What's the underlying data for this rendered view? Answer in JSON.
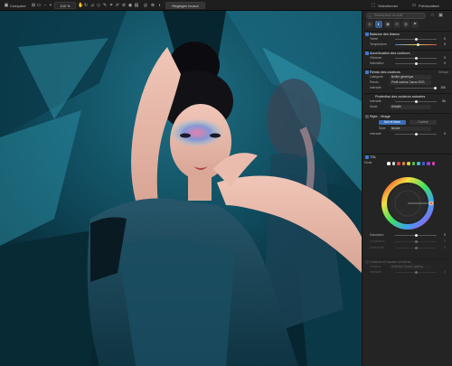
{
  "toolbar": {
    "compare_label": "Comparer",
    "zoom_value": "100 %",
    "preset_button": "Réglages locaux",
    "right_button": "Sélectionner",
    "preview_button": "Prévisualiser"
  },
  "panel": {
    "search_placeholder": "Rechercher un outil",
    "tabs": [
      "◎",
      "◐",
      "▣",
      "⊡",
      "◍",
      "⚑"
    ],
    "sections": {
      "white_balance": {
        "title": "Balance des blancs",
        "rows": [
          {
            "label": "Teinte",
            "value": "0"
          },
          {
            "label": "Température",
            "value": "0"
          }
        ]
      },
      "color_enhance": {
        "title": "Accentuation des couleurs",
        "rows": [
          {
            "label": "Vibrance",
            "value": "0"
          },
          {
            "label": "Saturation",
            "value": "0"
          }
        ]
      },
      "color_render": {
        "title": "Rendu des couleurs",
        "badge": "Défaut",
        "rows": [
          {
            "label": "Catégorie",
            "value": "Boîtier générique"
          },
          {
            "label": "Rendu",
            "value": "Profil couleur Canon EOS"
          },
          {
            "label": "Intensité",
            "value": "100"
          }
        ]
      },
      "skin_protect": {
        "title": "Protection des couleurs saturées",
        "rows": [
          {
            "label": "Intensité",
            "value": "50"
          },
          {
            "label": "Mode",
            "value": "Détaillé"
          }
        ]
      },
      "style_tint": {
        "title": "Style - Virage",
        "buttons": [
          "Noir et blanc",
          "Couleur"
        ],
        "rows": [
          {
            "label": "Style",
            "value": "Neutre"
          },
          {
            "label": "Intensité",
            "value": "0"
          }
        ]
      },
      "hsl": {
        "title": "TSL",
        "mode_label": "Mode",
        "dot_colors": [
          "#ffffff",
          "#d9d9d9",
          "#e04040",
          "#e08a2e",
          "#e0d040",
          "#55c040",
          "#40c0c0",
          "#4060e0",
          "#a040e0",
          "#e040b0"
        ],
        "rows": [
          {
            "label": "Saturation",
            "value": "0"
          },
          {
            "label": "Luminance",
            "value": "0"
          },
          {
            "label": "Uniformité",
            "value": "0"
          }
        ]
      },
      "shadows": {
        "title": "Ombres et hautes lumières",
        "rows": [
          {
            "label": "Ombres",
            "value": "Sélection Smart Lighting"
          },
          {
            "label": "Intensité",
            "value": "0"
          }
        ]
      }
    }
  }
}
